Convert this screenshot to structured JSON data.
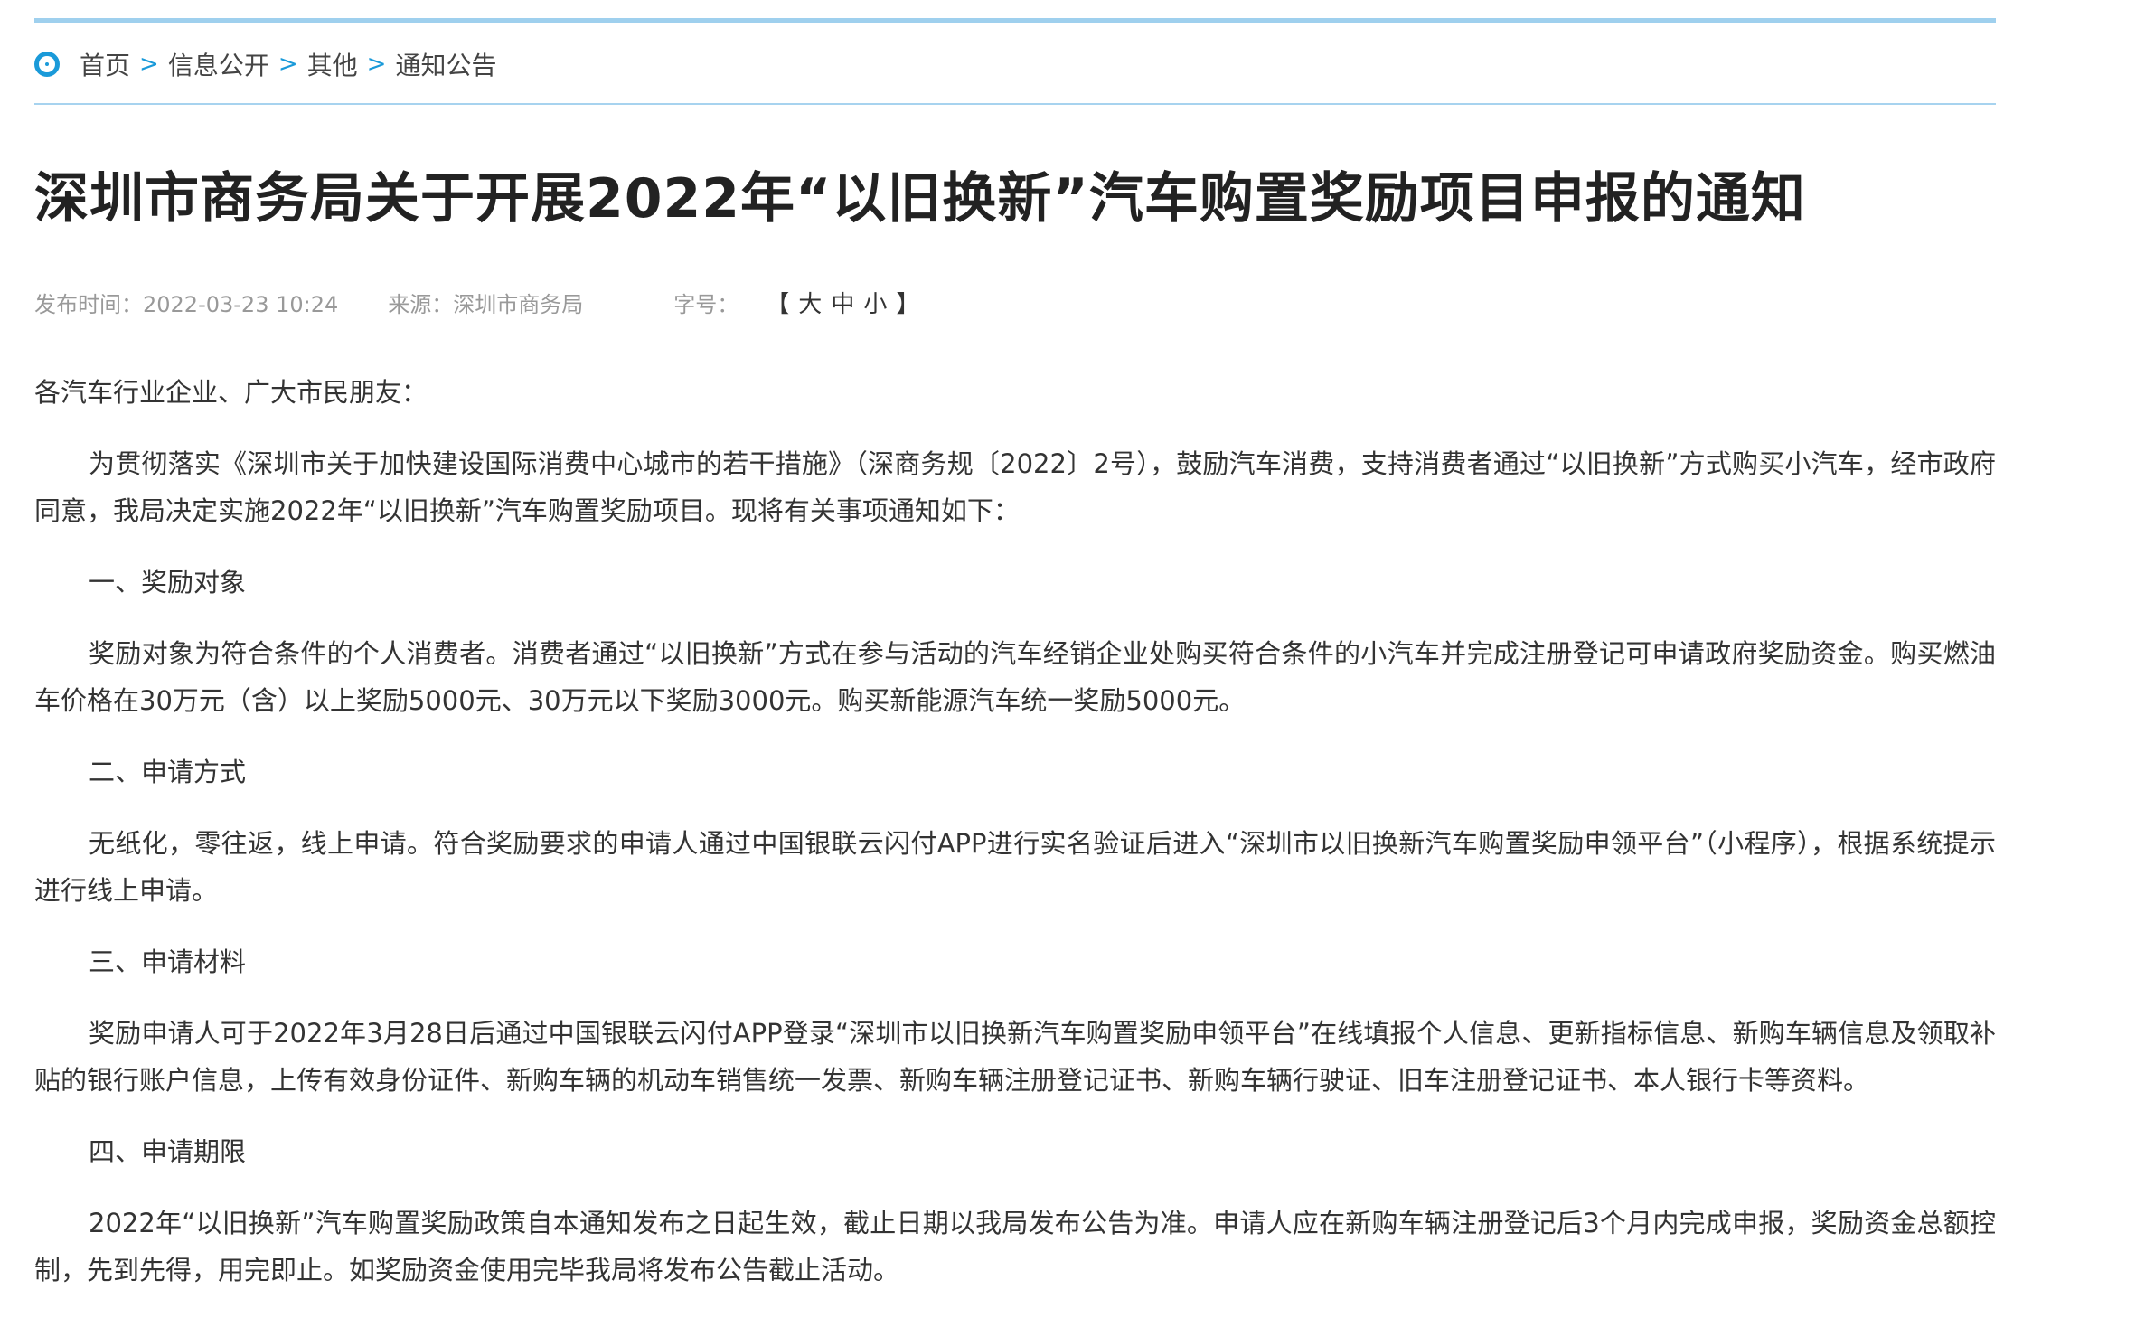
{
  "breadcrumb": {
    "items": [
      "首页",
      "信息公开",
      "其他",
      "通知公告"
    ],
    "separator": ">"
  },
  "article": {
    "title": "深圳市商务局关于开展2022年“以旧换新”汽车购置奖励项目申报的通知",
    "meta": {
      "publish_time": "发布时间：2022-03-23 10:24",
      "source": "来源：深圳市商务局",
      "font_size_label": "字号：",
      "font_size_open": "【",
      "font_size_large": "大",
      "font_size_medium": "中",
      "font_size_small": "小",
      "font_size_close": "】"
    },
    "salutation": "各汽车行业企业、广大市民朋友：",
    "intro": "为贯彻落实《深圳市关于加快建设国际消费中心城市的若干措施》（深商务规〔2022〕2号），鼓励汽车消费，支持消费者通过“以旧换新”方式购买小汽车，经市政府同意，我局决定实施2022年“以旧换新”汽车购置奖励项目。现将有关事项通知如下：",
    "sections": [
      {
        "heading": "一、奖励对象",
        "body": "奖励对象为符合条件的个人消费者。消费者通过“以旧换新”方式在参与活动的汽车经销企业处购买符合条件的小汽车并完成注册登记可申请政府奖励资金。购买燃油车价格在30万元（含）以上奖励5000元、30万元以下奖励3000元。购买新能源汽车统一奖励5000元。"
      },
      {
        "heading": "二、申请方式",
        "body": "无纸化，零往返，线上申请。符合奖励要求的申请人通过中国银联云闪付APP进行实名验证后进入“深圳市以旧换新汽车购置奖励申领平台”（小程序），根据系统提示进行线上申请。"
      },
      {
        "heading": "三、申请材料",
        "body": "奖励申请人可于2022年3月28日后通过中国银联云闪付APP登录“深圳市以旧换新汽车购置奖励申领平台”在线填报个人信息、更新指标信息、新购车辆信息及领取补贴的银行账户信息，上传有效身份证件、新购车辆的机动车销售统一发票、新购车辆注册登记证书、新购车辆行驶证、旧车注册登记证书、本人银行卡等资料。"
      },
      {
        "heading": "四、申请期限",
        "body": "2022年“以旧换新”汽车购置奖励政策自本通知发布之日起生效，截止日期以我局发布公告为准。申请人应在新购车辆注册登记后3个月内完成申报，奖励资金总额控制，先到先得，用完即止。如奖励资金使用完毕我局将发布公告截止活动。"
      }
    ]
  },
  "colors": {
    "accent": "#1a9ad9",
    "rule": "#9fd0ee",
    "meta_text": "#999999",
    "body_text": "#333333"
  }
}
